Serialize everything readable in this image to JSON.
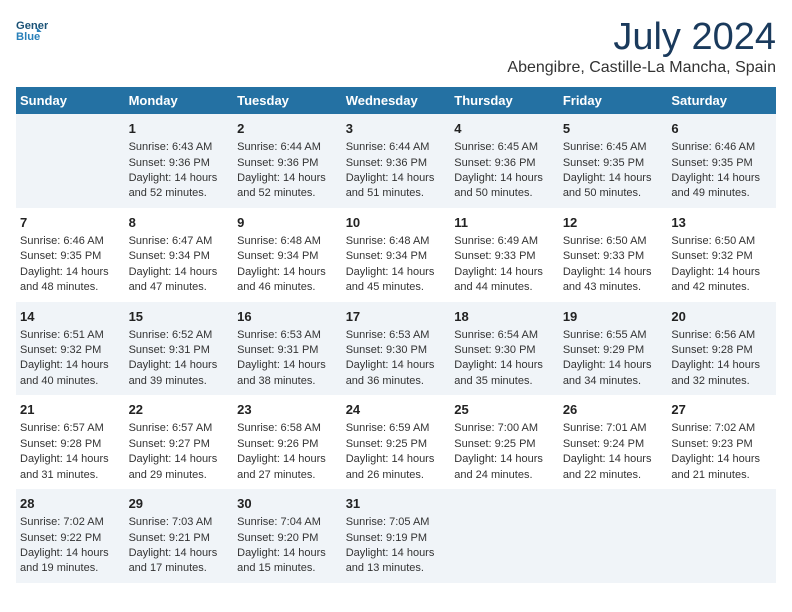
{
  "logo": {
    "line1": "General",
    "line2": "Blue"
  },
  "title": "July 2024",
  "subtitle": "Abengibre, Castille-La Mancha, Spain",
  "days_of_week": [
    "Sunday",
    "Monday",
    "Tuesday",
    "Wednesday",
    "Thursday",
    "Friday",
    "Saturday"
  ],
  "weeks": [
    [
      {
        "day": "",
        "info": ""
      },
      {
        "day": "1",
        "info": "Sunrise: 6:43 AM\nSunset: 9:36 PM\nDaylight: 14 hours\nand 52 minutes."
      },
      {
        "day": "2",
        "info": "Sunrise: 6:44 AM\nSunset: 9:36 PM\nDaylight: 14 hours\nand 52 minutes."
      },
      {
        "day": "3",
        "info": "Sunrise: 6:44 AM\nSunset: 9:36 PM\nDaylight: 14 hours\nand 51 minutes."
      },
      {
        "day": "4",
        "info": "Sunrise: 6:45 AM\nSunset: 9:36 PM\nDaylight: 14 hours\nand 50 minutes."
      },
      {
        "day": "5",
        "info": "Sunrise: 6:45 AM\nSunset: 9:35 PM\nDaylight: 14 hours\nand 50 minutes."
      },
      {
        "day": "6",
        "info": "Sunrise: 6:46 AM\nSunset: 9:35 PM\nDaylight: 14 hours\nand 49 minutes."
      }
    ],
    [
      {
        "day": "7",
        "info": "Sunrise: 6:46 AM\nSunset: 9:35 PM\nDaylight: 14 hours\nand 48 minutes."
      },
      {
        "day": "8",
        "info": "Sunrise: 6:47 AM\nSunset: 9:34 PM\nDaylight: 14 hours\nand 47 minutes."
      },
      {
        "day": "9",
        "info": "Sunrise: 6:48 AM\nSunset: 9:34 PM\nDaylight: 14 hours\nand 46 minutes."
      },
      {
        "day": "10",
        "info": "Sunrise: 6:48 AM\nSunset: 9:34 PM\nDaylight: 14 hours\nand 45 minutes."
      },
      {
        "day": "11",
        "info": "Sunrise: 6:49 AM\nSunset: 9:33 PM\nDaylight: 14 hours\nand 44 minutes."
      },
      {
        "day": "12",
        "info": "Sunrise: 6:50 AM\nSunset: 9:33 PM\nDaylight: 14 hours\nand 43 minutes."
      },
      {
        "day": "13",
        "info": "Sunrise: 6:50 AM\nSunset: 9:32 PM\nDaylight: 14 hours\nand 42 minutes."
      }
    ],
    [
      {
        "day": "14",
        "info": "Sunrise: 6:51 AM\nSunset: 9:32 PM\nDaylight: 14 hours\nand 40 minutes."
      },
      {
        "day": "15",
        "info": "Sunrise: 6:52 AM\nSunset: 9:31 PM\nDaylight: 14 hours\nand 39 minutes."
      },
      {
        "day": "16",
        "info": "Sunrise: 6:53 AM\nSunset: 9:31 PM\nDaylight: 14 hours\nand 38 minutes."
      },
      {
        "day": "17",
        "info": "Sunrise: 6:53 AM\nSunset: 9:30 PM\nDaylight: 14 hours\nand 36 minutes."
      },
      {
        "day": "18",
        "info": "Sunrise: 6:54 AM\nSunset: 9:30 PM\nDaylight: 14 hours\nand 35 minutes."
      },
      {
        "day": "19",
        "info": "Sunrise: 6:55 AM\nSunset: 9:29 PM\nDaylight: 14 hours\nand 34 minutes."
      },
      {
        "day": "20",
        "info": "Sunrise: 6:56 AM\nSunset: 9:28 PM\nDaylight: 14 hours\nand 32 minutes."
      }
    ],
    [
      {
        "day": "21",
        "info": "Sunrise: 6:57 AM\nSunset: 9:28 PM\nDaylight: 14 hours\nand 31 minutes."
      },
      {
        "day": "22",
        "info": "Sunrise: 6:57 AM\nSunset: 9:27 PM\nDaylight: 14 hours\nand 29 minutes."
      },
      {
        "day": "23",
        "info": "Sunrise: 6:58 AM\nSunset: 9:26 PM\nDaylight: 14 hours\nand 27 minutes."
      },
      {
        "day": "24",
        "info": "Sunrise: 6:59 AM\nSunset: 9:25 PM\nDaylight: 14 hours\nand 26 minutes."
      },
      {
        "day": "25",
        "info": "Sunrise: 7:00 AM\nSunset: 9:25 PM\nDaylight: 14 hours\nand 24 minutes."
      },
      {
        "day": "26",
        "info": "Sunrise: 7:01 AM\nSunset: 9:24 PM\nDaylight: 14 hours\nand 22 minutes."
      },
      {
        "day": "27",
        "info": "Sunrise: 7:02 AM\nSunset: 9:23 PM\nDaylight: 14 hours\nand 21 minutes."
      }
    ],
    [
      {
        "day": "28",
        "info": "Sunrise: 7:02 AM\nSunset: 9:22 PM\nDaylight: 14 hours\nand 19 minutes."
      },
      {
        "day": "29",
        "info": "Sunrise: 7:03 AM\nSunset: 9:21 PM\nDaylight: 14 hours\nand 17 minutes."
      },
      {
        "day": "30",
        "info": "Sunrise: 7:04 AM\nSunset: 9:20 PM\nDaylight: 14 hours\nand 15 minutes."
      },
      {
        "day": "31",
        "info": "Sunrise: 7:05 AM\nSunset: 9:19 PM\nDaylight: 14 hours\nand 13 minutes."
      },
      {
        "day": "",
        "info": ""
      },
      {
        "day": "",
        "info": ""
      },
      {
        "day": "",
        "info": ""
      }
    ]
  ]
}
